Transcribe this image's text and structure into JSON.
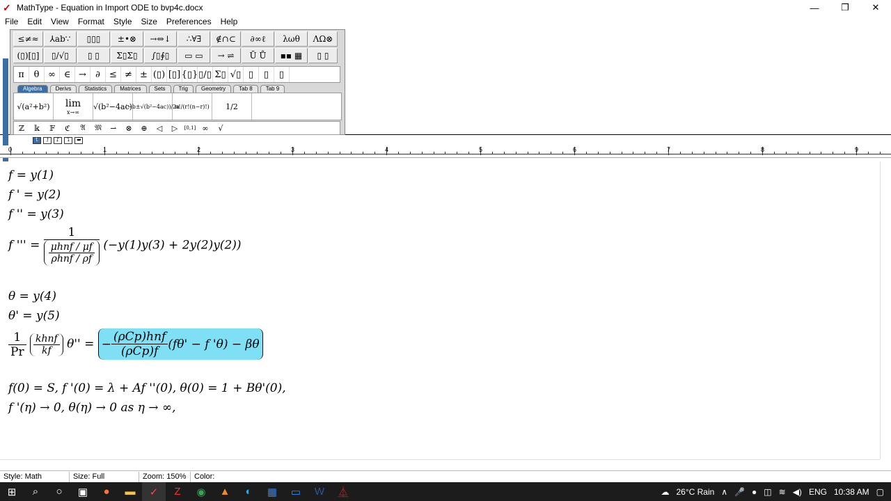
{
  "window": {
    "title": "MathType - Equation in Import ODE to bvp4c.docx",
    "minimize": "—",
    "maximize": "❐",
    "close": "✕"
  },
  "menu": [
    "File",
    "Edit",
    "View",
    "Format",
    "Style",
    "Size",
    "Preferences",
    "Help"
  ],
  "palette": {
    "row1": [
      "≤≠≈",
      "⅄ab∵",
      "▯▯▯",
      "±•⊗",
      "→⇔↓",
      "∴∀∃",
      "∉∩⊂",
      "∂∞ℓ",
      "λωθ",
      "ΛΩ⊗"
    ],
    "row2": [
      "(▯)[▯]",
      "▯/√▯",
      "▯ ▯",
      "Σ▯Σ▯",
      "∫▯∮▯",
      "▭ ▭",
      "→ ⇌",
      "Ū Ů",
      "▪▪ ▦",
      "▯ ▯"
    ],
    "row3": [
      "π",
      "θ",
      "∞",
      "∈",
      "→",
      "∂",
      "≤",
      "≠",
      "±",
      "(▯)",
      "[▯]",
      "{▯}",
      "▯/▯",
      "Σ▯",
      "√▯",
      "▯",
      "▯",
      "▯"
    ],
    "tabs": [
      "Algebra",
      "Derivs",
      "Statistics",
      "Matrices",
      "Sets",
      "Trig",
      "Geometry",
      "Tab 8",
      "Tab 9"
    ],
    "templates": [
      "√(a²+b²)",
      "lim",
      "x→∞",
      "√(b²−4ac)",
      "(−b±√(b²−4ac))/2a",
      "n!/(r!(n−r)!)",
      "1/2"
    ],
    "row5": [
      "ℤ",
      "𝕜",
      "𝔽",
      "ℭ",
      "𝔄",
      "𝔐",
      "⇀",
      "⊗",
      "⊕",
      "◁",
      "▷",
      "[0,1]",
      "∞",
      "√"
    ]
  },
  "ruler": {
    "labels": [
      "0",
      "1",
      "2",
      "3",
      "4",
      "5",
      "6",
      "7",
      "8",
      "9"
    ]
  },
  "tabstops": [
    "⮤",
    "⮥",
    "⮦",
    "⮧",
    "⮨"
  ],
  "equations": {
    "l1": "f = y(1)",
    "l2": "f ' = y(2)",
    "l3": "f '' = y(3)",
    "l4_lhs": "f ''' =",
    "l4_num": "1",
    "l4_den_top": "μhnf / μf",
    "l4_den_bot": "ρhnf / ρf",
    "l4_rhs": "(−y(1)y(3) + 2y(2)y(2))",
    "l5": "θ = y(4)",
    "l6": "θ' = y(5)",
    "l7_pr_num": "1",
    "l7_pr_den": "Pr",
    "l7_k_num": "khnf",
    "l7_k_den": "kf",
    "l7_mid": "θ'' =",
    "l7_rc_num": "(ρCp)hnf",
    "l7_rc_den": "(ρCp)f",
    "l7_rhs": "(fθ' − f 'θ) − βθ",
    "l8": "f(0) = S, f '(0) = λ + Af ''(0), θ(0) = 1 + Bθ'(0),",
    "l9": "f '(η) → 0, θ(η) → 0 as η → ∞,"
  },
  "status": {
    "style": "Style: Math",
    "size": "Size: Full",
    "zoom": "Zoom: 150%",
    "color": "Color:"
  },
  "taskbar": {
    "icons": [
      "windows-start",
      "search",
      "cortana",
      "task-view",
      "firefox",
      "file-explorer",
      "mathtype",
      "app-red",
      "chrome",
      "matlab",
      "edge",
      "app-blue",
      "app-zoom",
      "word",
      "acrobat"
    ],
    "weather": "26°C  Rain",
    "lang": "ENG",
    "time": "10:38 AM"
  }
}
